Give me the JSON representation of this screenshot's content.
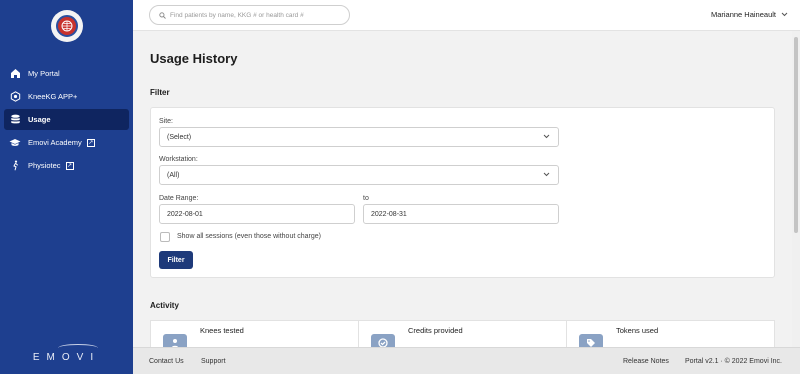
{
  "app": {
    "brand": "EMOVI"
  },
  "sidebar": {
    "items": [
      {
        "label": "My Portal",
        "icon": "home-icon"
      },
      {
        "label": "KneeKG APP+",
        "icon": "knee-app-icon"
      },
      {
        "label": "Usage",
        "icon": "database-icon",
        "active": true
      },
      {
        "label": "Emovi Academy",
        "icon": "graduation-cap-icon"
      },
      {
        "label": "Physiotec",
        "icon": "person-icon"
      }
    ]
  },
  "header": {
    "search_placeholder": "Find patients by name, KKG # or health card #",
    "user_name": "Marianne Haineault"
  },
  "page": {
    "title": "Usage History",
    "filter_title": "Filter",
    "site_label": "Site:",
    "site_value": "(Select)",
    "workstation_label": "Workstation:",
    "workstation_value": "(All)",
    "date_range_label": "Date Range:",
    "date_from": "2022-08-01",
    "to_label": "to",
    "date_to": "2022-08-31",
    "show_all_label": "Show all sessions (even those without charge)",
    "filter_button": "Filter",
    "activity_title": "Activity",
    "stats": [
      {
        "label": "Knees tested",
        "icon": "person-icon"
      },
      {
        "label": "Credits provided",
        "icon": "check-circle-icon"
      },
      {
        "label": "Tokens used",
        "icon": "tag-icon"
      }
    ]
  },
  "footer": {
    "contact": "Contact Us",
    "support": "Support",
    "release_notes": "Release Notes",
    "version": "Portal v2.1 · © 2022 Emovi Inc."
  },
  "colors": {
    "sidebar": "#1e3f8f",
    "active_item": "#0f2560",
    "button": "#1e3a7a"
  }
}
